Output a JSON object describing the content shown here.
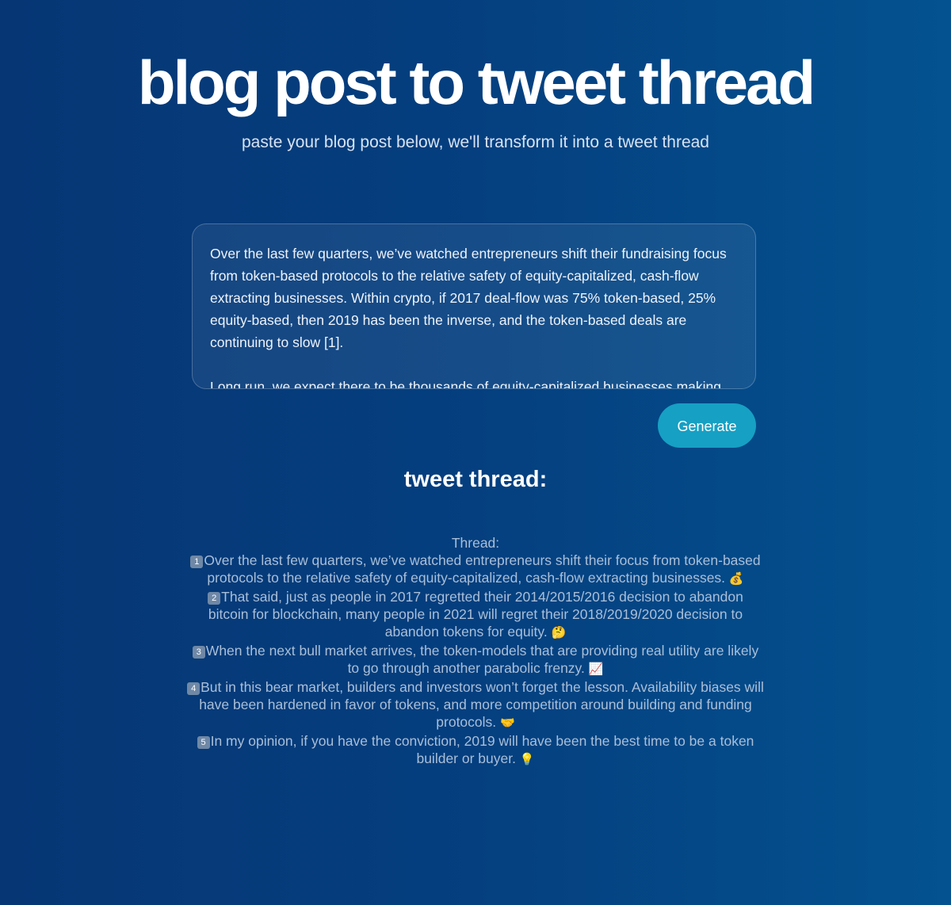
{
  "header": {
    "title": "blog post to tweet thread",
    "subtitle": "paste your blog post below, we'll transform it into a tweet thread"
  },
  "input": {
    "text": "Over the last few quarters, we’ve watched entrepreneurs shift their fundraising focus from token-based protocols to the relative safety of equity-capitalized, cash-flow extracting businesses. Within crypto, if 2017 deal-flow was 75% token-based, 25% equity-based, then 2019 has been the inverse, and the token-based deals are continuing to slow [1].\n\nLong run, we expect there to be thousands of equity-capitalized businesses making"
  },
  "generate_label": "Generate",
  "output": {
    "heading": "tweet thread:",
    "intro": "Thread:",
    "tweets": [
      {
        "num": "1",
        "text": "Over the last few quarters, we’ve watched entrepreneurs shift their focus from token-based protocols to the relative safety of equity-capitalized, cash-flow extracting businesses.",
        "emoji": "💰"
      },
      {
        "num": "2",
        "text": "That said, just as people in 2017 regretted their 2014/2015/2016 decision to abandon bitcoin for blockchain, many people in 2021 will regret their 2018/2019/2020 decision to abandon tokens for equity.",
        "emoji": "🤔"
      },
      {
        "num": "3",
        "text": "When the next bull market arrives, the token-models that are providing real utility are likely to go through another parabolic frenzy.",
        "emoji": "📈"
      },
      {
        "num": "4",
        "text": "But in this bear market, builders and investors won’t forget the lesson. Availability biases will have been hardened in favor of tokens, and more competition around building and funding protocols.",
        "emoji": "🤝"
      },
      {
        "num": "5",
        "text": "In my opinion, if you have the conviction, 2019 will have been the best time to be a token builder or buyer.",
        "emoji": "💡"
      }
    ]
  }
}
